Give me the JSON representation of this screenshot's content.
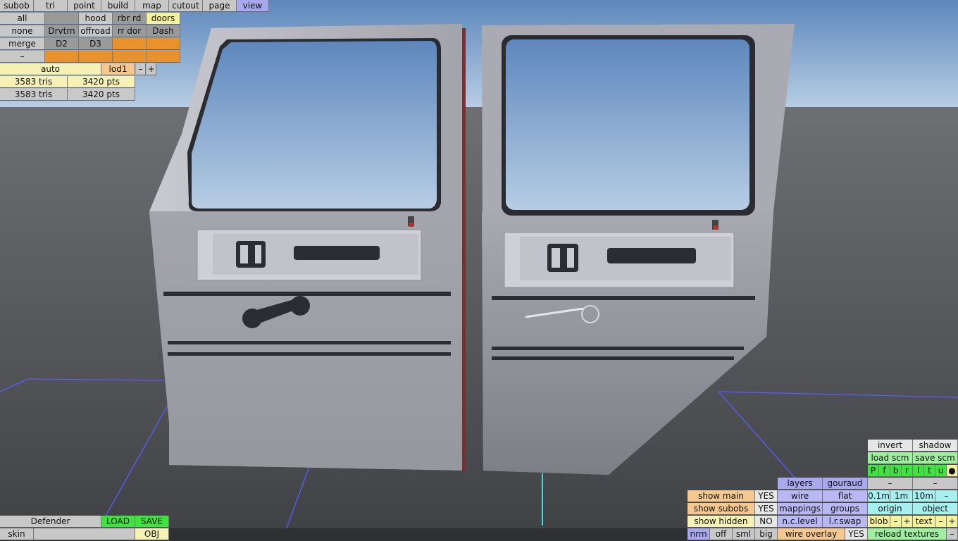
{
  "menu": [
    "subob",
    "tri",
    "point",
    "build",
    "map",
    "cutout",
    "page",
    "view"
  ],
  "groups": {
    "row1": [
      "all",
      "",
      "hood",
      "rbr rd",
      "doors"
    ],
    "row2": [
      "none",
      "Drvtrn",
      "offroad",
      "rr dor",
      "Dash"
    ],
    "row3": [
      "merge",
      "D2",
      "D3",
      "",
      ""
    ],
    "row4": [
      "–",
      "",
      "",
      "",
      ""
    ]
  },
  "lod": {
    "mode": "auto",
    "level": "lod1",
    "minus": "–",
    "plus": "+"
  },
  "stats": [
    {
      "tris": "3583 tris",
      "pts": "3420 pts"
    },
    {
      "tris": "3583 tris",
      "pts": "3420 pts"
    }
  ],
  "file": {
    "name": "Defender",
    "load": "LOAD",
    "save": "SAVE",
    "skin": "skin",
    "skin_value": "",
    "format": "OBJ"
  },
  "view_panel": {
    "invert": "invert",
    "shadow": "shadow",
    "load_scm": "load scm",
    "save_scm": "save scm",
    "planes": [
      "P",
      "f",
      "b",
      "r",
      "l",
      "t",
      "u",
      "●"
    ],
    "layers": "layers",
    "gouraud": "gouraud",
    "dash1": "–",
    "dash2": "–",
    "wire": "wire",
    "flat": "flat",
    "scale": [
      "0.1m",
      "1m",
      "10m",
      "–"
    ],
    "mappings": "mappings",
    "groups": "groups",
    "origin": "origin",
    "object": "object",
    "nclevel": "n.c.level",
    "lrswap": "l.r.swap",
    "blob": "blob",
    "blob_minus": "–",
    "blob_plus": "+",
    "text": "text",
    "text_minus": "–",
    "text_plus": "+",
    "show_main": "show main",
    "show_main_val": "YES",
    "show_subobs": "show subobs",
    "show_subobs_val": "YES",
    "show_hidden": "show hidden",
    "show_hidden_val": "NO",
    "nrm": "nrm",
    "off": "off",
    "sml": "sml",
    "big": "big",
    "wire_overlay": "wire overlay",
    "wire_overlay_val": "YES",
    "reload": "reload textures",
    "reload_minus": "–"
  }
}
